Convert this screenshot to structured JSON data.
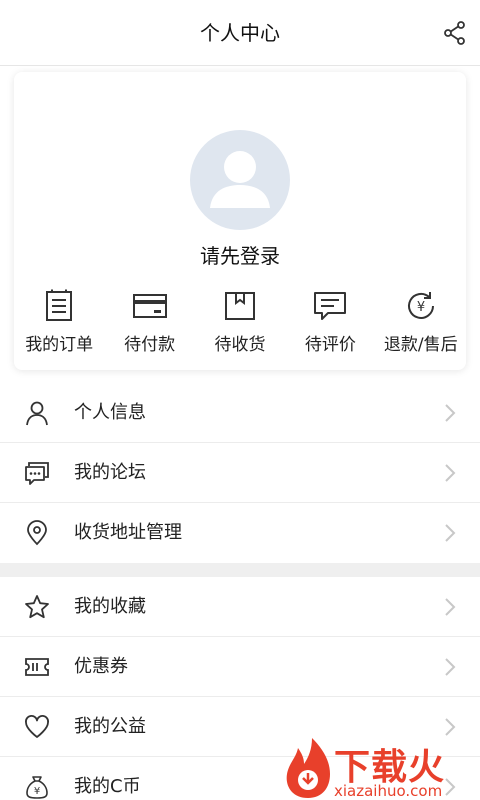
{
  "header": {
    "title": "个人中心",
    "share_icon": "share-icon"
  },
  "profile": {
    "login_prompt": "请先登录",
    "avatar_icon": "default-avatar-icon"
  },
  "orders": [
    {
      "label": "我的订单",
      "icon": "order-list-icon"
    },
    {
      "label": "待付款",
      "icon": "card-icon"
    },
    {
      "label": "待收货",
      "icon": "package-icon"
    },
    {
      "label": "待评价",
      "icon": "comment-icon"
    },
    {
      "label": "退款/售后",
      "icon": "refund-icon"
    }
  ],
  "menu_group_1": [
    {
      "label": "个人信息",
      "icon": "user-icon"
    },
    {
      "label": "我的论坛",
      "icon": "forum-icon"
    },
    {
      "label": "收货地址管理",
      "icon": "location-icon"
    }
  ],
  "menu_group_2": [
    {
      "label": "我的收藏",
      "icon": "star-icon"
    },
    {
      "label": "优惠券",
      "icon": "coupon-icon"
    },
    {
      "label": "我的公益",
      "icon": "heart-icon"
    },
    {
      "label": "我的C币",
      "icon": "money-bag-icon"
    }
  ],
  "watermark": {
    "brand": "下载火",
    "url": "xiazaihuo.com"
  },
  "colors": {
    "watermark": "#e8402b",
    "avatar_bg": "#dfe6ef",
    "divider": "#efefef"
  }
}
